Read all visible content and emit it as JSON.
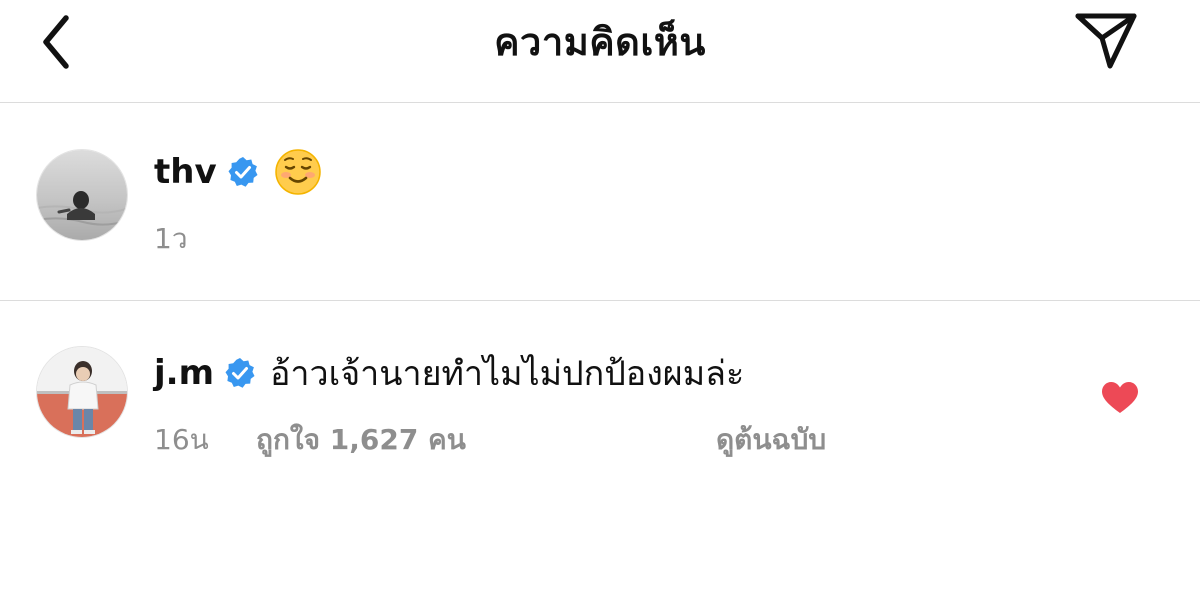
{
  "header": {
    "title": "ความคิดเห็น",
    "back_icon": "chevron-left-icon",
    "share_icon": "paper-plane-icon"
  },
  "comments": [
    {
      "username": "thv",
      "verified": true,
      "text": "☺️",
      "time": "1ว"
    },
    {
      "username": "j.m",
      "verified": true,
      "text": "อ้าวเจ้านายทำไมไม่ปกป้องผมล่ะ",
      "time": "16น",
      "likes_label": "ถูกใจ 1,627 คน",
      "translate_label": "ดูต้นฉบับ",
      "liked": true
    }
  ],
  "colors": {
    "verified_badge": "#3897f0",
    "liked_heart": "#ed4956",
    "meta_text": "#8e8e8e",
    "divider": "#dcdcdc"
  }
}
